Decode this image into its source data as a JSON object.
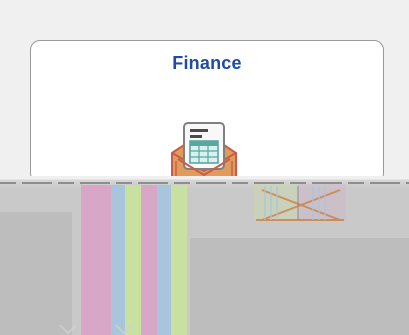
{
  "tile": {
    "title": "Finance",
    "icon": "finance-invoice-icon"
  },
  "colors": {
    "title_blue": "#1f4aa6",
    "tile_border": "#9a9a9a",
    "bg_light": "#f0f0f0",
    "bg_gray": "#c9c9c9",
    "pastel_pink": "#d8a6c6",
    "pastel_blue": "#a7c6dd",
    "pastel_green": "#c8e0a0",
    "icon_orange": "#e19b5b",
    "icon_red": "#c75c4b",
    "icon_teal": "#5aa6a0"
  }
}
